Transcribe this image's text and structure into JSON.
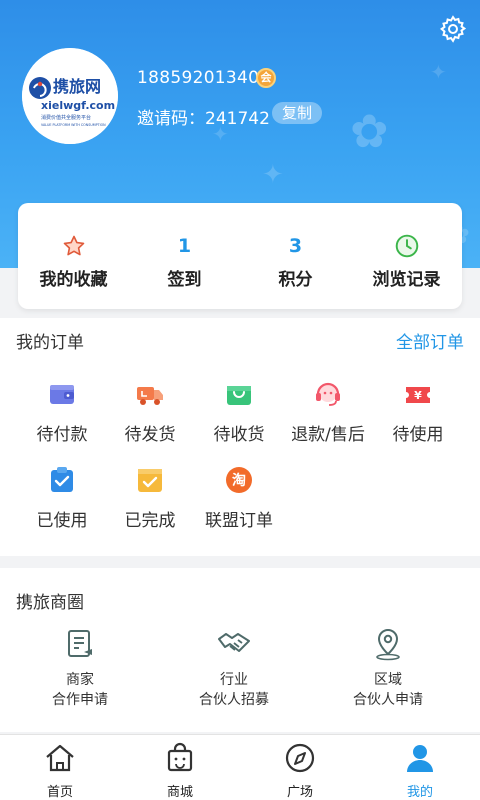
{
  "header": {
    "phone": "18859201340",
    "level_badge": "会",
    "invite_label": "邀请码：241742",
    "copy_label": "复制",
    "logo": {
      "title": "携旅网",
      "domain": "xielwgf.com",
      "slogan": "消费价值共全服务平台",
      "subslogan": "VALUE PLATFORM WITH CONSUMPTION"
    },
    "accent": "#2e8ee8"
  },
  "quick": [
    {
      "top": "★",
      "label": "我的收藏",
      "icon": "star-icon"
    },
    {
      "top": "1",
      "label": "签到",
      "icon": ""
    },
    {
      "top": "3",
      "label": "积分",
      "icon": ""
    },
    {
      "top": "",
      "label": "浏览记录",
      "icon": "clock-icon"
    }
  ],
  "orders": {
    "title": "我的订单",
    "all_label": "全部订单",
    "items": [
      {
        "label": "待付款",
        "icon": "wallet-icon"
      },
      {
        "label": "待发货",
        "icon": "truck-icon"
      },
      {
        "label": "待收货",
        "icon": "bag-icon"
      },
      {
        "label": "退款/售后",
        "icon": "headset-icon"
      },
      {
        "label": "待使用",
        "icon": "ticket-icon"
      },
      {
        "label": "已使用",
        "icon": "clipboard-check-icon"
      },
      {
        "label": "已完成",
        "icon": "done-check-icon"
      },
      {
        "label": "联盟订单",
        "icon": "taobao-icon"
      }
    ],
    "taobao_char": "淘",
    "ticket_char": "¥"
  },
  "circle": {
    "title": "携旅商圈",
    "items": [
      {
        "line1": "商家",
        "line2": "合作申请",
        "icon": "merchant-doc-icon"
      },
      {
        "line1": "行业",
        "line2": "合伙人招募",
        "icon": "handshake-icon"
      },
      {
        "line1": "区域",
        "line2": "合伙人申请",
        "icon": "location-pin-icon"
      }
    ]
  },
  "tabs": [
    {
      "label": "首页",
      "icon": "home-icon"
    },
    {
      "label": "商城",
      "icon": "shopping-bag-icon"
    },
    {
      "label": "广场",
      "icon": "compass-icon"
    },
    {
      "label": "我的",
      "icon": "user-icon",
      "active": true
    }
  ]
}
